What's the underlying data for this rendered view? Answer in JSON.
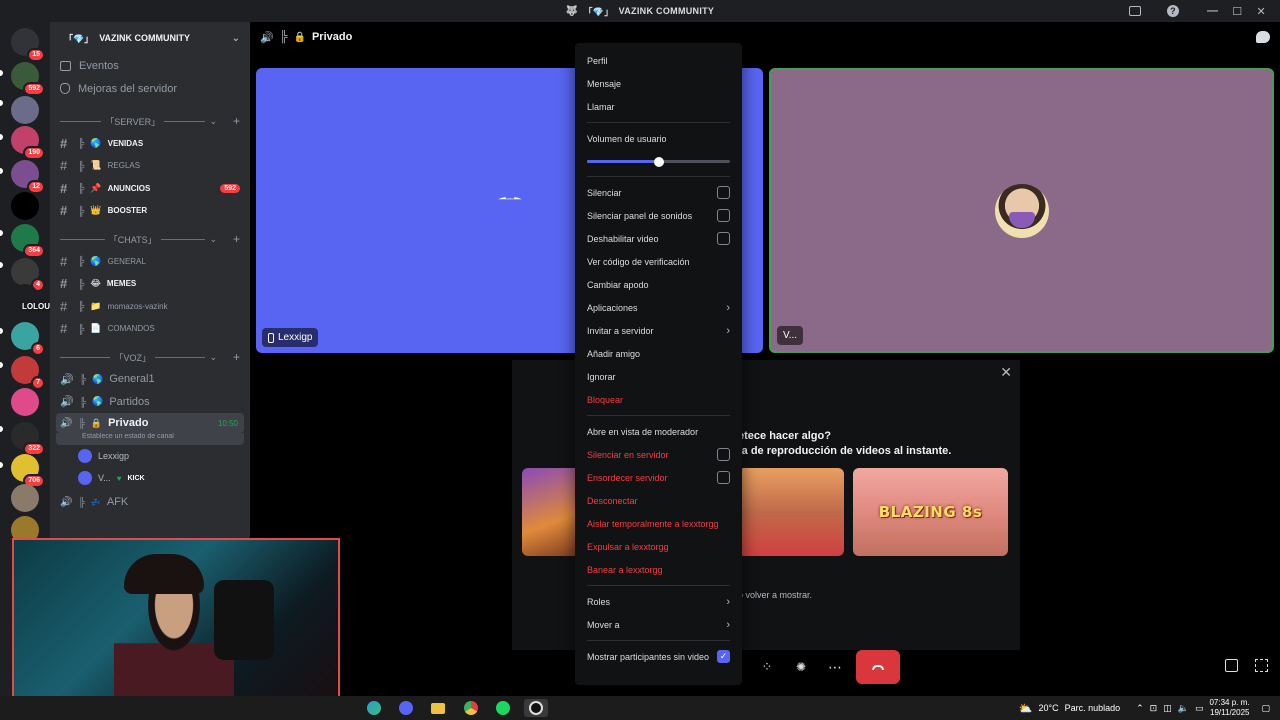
{
  "window": {
    "title": "VAZINK COMMUNITY",
    "title_prefix": "「💎」"
  },
  "rail": {
    "servers": [
      {
        "name": "discord-home",
        "badge": "15",
        "color": "#313338"
      },
      {
        "name": "server-1",
        "badge": "592",
        "color": "#3b5a3a"
      },
      {
        "name": "server-squad",
        "badge": "",
        "color": "#6b6b8a"
      },
      {
        "name": "server-3",
        "badge": "190",
        "color": "#c2416b"
      },
      {
        "name": "server-4",
        "badge": "12",
        "color": "#7a4e8f"
      },
      {
        "name": "server-tiktok",
        "badge": "",
        "color": "#000000"
      },
      {
        "name": "server-6",
        "badge": "364",
        "color": "#1f7a4a"
      },
      {
        "name": "server-7",
        "badge": "4",
        "color": "#3a3a3a"
      },
      {
        "name": "server-kick",
        "badge": "",
        "color": "#1e1f22"
      },
      {
        "name": "server-9",
        "badge": "6",
        "color": "#3aa4a0"
      },
      {
        "name": "server-10",
        "badge": "7",
        "color": "#c23a3a"
      },
      {
        "name": "server-11",
        "badge": "",
        "color": "#e04a8a"
      },
      {
        "name": "server-12",
        "badge": "322",
        "color": "#2a2a2a"
      },
      {
        "name": "server-13",
        "badge": "706",
        "color": "#e0c030"
      },
      {
        "name": "server-14",
        "badge": "",
        "color": "#8a7a6a"
      },
      {
        "name": "server-15",
        "badge": "",
        "color": "#9a7a2a"
      }
    ],
    "overlay_text": "LOLOUKOS"
  },
  "sidebar": {
    "server_name": "VAZINK COMMUNITY",
    "server_prefix": "「💎」",
    "events_label": "Eventos",
    "boosts_label": "Mejoras del servidor",
    "categories": {
      "server": "「SERVER」",
      "chats": "「CHATS」",
      "voz": "「VOZ」"
    },
    "server_channels": [
      {
        "name": "VENIDAS",
        "emoji": "🌎",
        "bold": true
      },
      {
        "name": "REGLAS",
        "emoji": "📜",
        "bold": false
      },
      {
        "name": "ANUNCIOS",
        "emoji": "📌",
        "bold": true,
        "badge": "592"
      },
      {
        "name": "BOOSTER",
        "emoji": "👑",
        "bold": true
      }
    ],
    "chat_channels": [
      {
        "name": "GENERAL",
        "emoji": "🌎",
        "bold": false
      },
      {
        "name": "MEMES",
        "emoji": "😂",
        "bold": true
      },
      {
        "name": "momazos-vazink",
        "emoji": "📁",
        "bold": false
      },
      {
        "name": "COMANDOS",
        "emoji": "📄",
        "bold": false
      }
    ],
    "voice_channels": [
      {
        "name": "General1",
        "emoji": "🌎"
      },
      {
        "name": "Partidos",
        "emoji": "🌎"
      }
    ],
    "active_voice": {
      "name": "Privado",
      "emoji": "🔒",
      "timer": "10:50",
      "status": "Establece un estado de canal"
    },
    "voice_users": [
      {
        "name": "Lexxigp",
        "tag": ""
      },
      {
        "name": "V...",
        "tag": "KICK"
      }
    ],
    "afk_channel": "AFK"
  },
  "main": {
    "header_title": "Privado",
    "tile_left_label": "Lexxigp",
    "tile_right_label": "V...",
    "activity_heading": "etece hacer algo?",
    "activity_sub": "ta de reproducción de videos al instante.",
    "activity_footer": "o volver a mostrar.",
    "game_card_text": "BLAZING 8s"
  },
  "context_menu": {
    "items_top": [
      "Perfil",
      "Mensaje",
      "Llamar"
    ],
    "volume_label": "Volumen de usuario",
    "volume_value": 0.5,
    "checkbox_items": [
      "Silenciar",
      "Silenciar panel de sonidos",
      "Deshabilitar video"
    ],
    "items_mid": [
      "Ver código de verificación",
      "Cambiar apodo"
    ],
    "submenu_items": [
      "Aplicaciones",
      "Invitar a servidor"
    ],
    "items_mid2": [
      "Añadir amigo",
      "Ignorar"
    ],
    "block_label": "Bloquear",
    "mod_label": "Abre en vista de moderador",
    "mod_checkbox_items": [
      "Silenciar en servidor",
      "Ensordecer servidor"
    ],
    "danger_items": [
      "Desconectar",
      "Aislar temporalmente a lexxtorgg",
      "Expulsar a lexxtorgg",
      "Banear a lexxtorgg"
    ],
    "roles_label": "Roles",
    "move_label": "Mover a",
    "show_no_video_label": "Mostrar participantes sin video",
    "show_no_video_checked": true
  },
  "taskbar": {
    "weather": "20°C",
    "weather_desc": "Parc. nublado",
    "time": "07:34 p. m.",
    "date": "19/11/2025"
  }
}
